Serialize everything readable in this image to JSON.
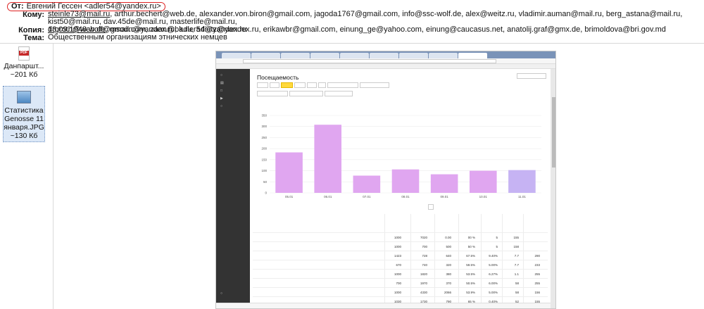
{
  "email": {
    "from_label": "От:",
    "from_value": "Евгений Гессен <adler54@yandex.ru>",
    "to_label": "Кому:",
    "to_first": "steinle73@mail.ru",
    "to_rest_line1": ", arthur.bechert@web.de, alexander.von.biron@gmail.com, jagoda1767@gmail.com, info@ssc-wolf.de, alex@weitz.ru, vladimir.auman@mail.ru, berg_astana@mail.ru, kist50@mail.ru, dav.45de@mail.ru, masterlife@mail.ru,",
    "to_line2": "13.09.1948.wolf@gmail.com, zaan@bk.ru, adietz@yandex.ru, erikawbr@gmail.com, einung_ge@yahoo.com, einung@caucasus.net, anatolij.graf@gmx.de, brimoldova@bri.gov.md",
    "cc_label": "Копия:",
    "cc_first": "drgroth@web.de",
    "cc_rest": ", msoon@yandex.ru, adler54@yandex.ru",
    "subject_label": "Тема:",
    "subject_value": "Общественным организациям этнических немцев"
  },
  "attachments": [
    {
      "name_line1": "Данпаршт...",
      "name_line2": "~201 Кб",
      "icon": "pdf-icon"
    },
    {
      "name_line1": "Статистика",
      "name_line2": "Genosse 11",
      "name_line3": "января.JPG",
      "name_line4": "~130 Кб",
      "icon": "image-icon"
    }
  ],
  "screenshot": {
    "page_title": "Посещаемость",
    "chart_data": {
      "type": "bar",
      "categories": [
        "05.01",
        "06.01",
        "07.01",
        "08.01",
        "09.01",
        "10.01",
        "11.01"
      ],
      "values": [
        183,
        308,
        78,
        106,
        84,
        100,
        103
      ],
      "ylim": [
        0,
        350
      ],
      "yticks": [
        0,
        50,
        100,
        150,
        200,
        250,
        300,
        350
      ],
      "grid": true,
      "colors": [
        "#e0a6f0",
        "#e0a6f0",
        "#e0a6f0",
        "#e0a6f0",
        "#e0a6f0",
        "#e0a6f0",
        "#c6b3f3"
      ]
    },
    "table_rows": [
      {
        "date": "",
        "values": [
          "1000",
          "7020",
          "0.00",
          "00 %",
          "5",
          "155"
        ]
      },
      {
        "date": "",
        "values": [
          "1000",
          "700",
          "500",
          "50 %",
          "5",
          "158"
        ]
      },
      {
        "date": "",
        "values": [
          "1423",
          "728",
          "640",
          "67.5%",
          "9.40%",
          "7.7",
          "290"
        ]
      },
      {
        "date": "",
        "values": [
          "670",
          "740",
          "320",
          "59.5%",
          "5.00%",
          "7.7",
          "233"
        ]
      },
      {
        "date": "",
        "values": [
          "1000",
          "1820",
          "380",
          "53.5%",
          "6.27%",
          "1.1",
          "255"
        ]
      },
      {
        "date": "",
        "values": [
          "700",
          "1970",
          "370",
          "50.5%",
          "6.00%",
          "58",
          "255"
        ]
      },
      {
        "date": "",
        "values": [
          "1000",
          "4330",
          "2066",
          "53.9%",
          "5.00%",
          "58",
          "156"
        ]
      },
      {
        "date": "",
        "values": [
          "1030",
          "1730",
          "790",
          "65 %",
          "0.40%",
          "52",
          "155"
        ]
      }
    ],
    "colors": {
      "sidebar": "#333333",
      "accent": "#ffd93b",
      "link_red": "#cc2233"
    }
  }
}
